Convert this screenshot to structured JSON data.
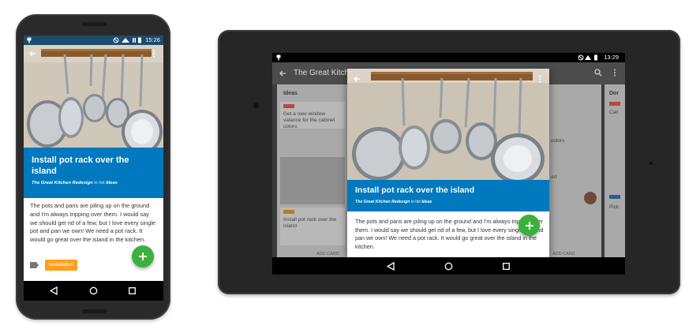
{
  "colors": {
    "brand_blue": "#0079bf",
    "fab_green": "#3cb03c",
    "label_orange": "#ff9f1a",
    "label_red": "#eb5a46",
    "status_bar_phone": "#1b4b6e"
  },
  "phone": {
    "status_time": "15:26",
    "card_title": "Install pot rack over the island",
    "board_name": "The Great Kitchen Redesign",
    "in_list_text": "in list",
    "list_name": "Ideas",
    "description": "The pots and pans are piling up on the ground and I'm always tripping over them. I would say we should get rid of a few, but I love every single pot and pan we own! We need a pot rack. It would go great over the island in the kitchen.",
    "label_text": "Installation",
    "icons": [
      "back-arrow-icon",
      "overflow-menu-icon",
      "tag-icon",
      "plus-icon",
      "nav-back-icon",
      "nav-home-icon",
      "nav-recents-icon"
    ]
  },
  "tablet": {
    "status_time": "13:29",
    "board_title": "The Great Kitchen",
    "background": {
      "list_title": "Ideas",
      "card_text": "Get a new window valance for the cabinet colors",
      "card2_text": "Install pot rack over the island",
      "add_card_left": "ADD CARD",
      "add_card_right": "ADD CARD",
      "right_col_title": "Dor",
      "right_col_text1": "Cali",
      "right_col_text2": "Pick",
      "mid_text1": "colors",
      "mid_text2": "art"
    },
    "card_title": "Install pot rack over the island",
    "board_name": "The Great Kitchen Redesign",
    "in_list_text": "in list",
    "list_name": "Ideas",
    "description": "The pots and pans are piling up on the ground and I'm always tripping over them. I would say we should get rid of a few, but I love every single pot and pan we own! We need a pot rack. It would go great over the island in the kitchen."
  }
}
